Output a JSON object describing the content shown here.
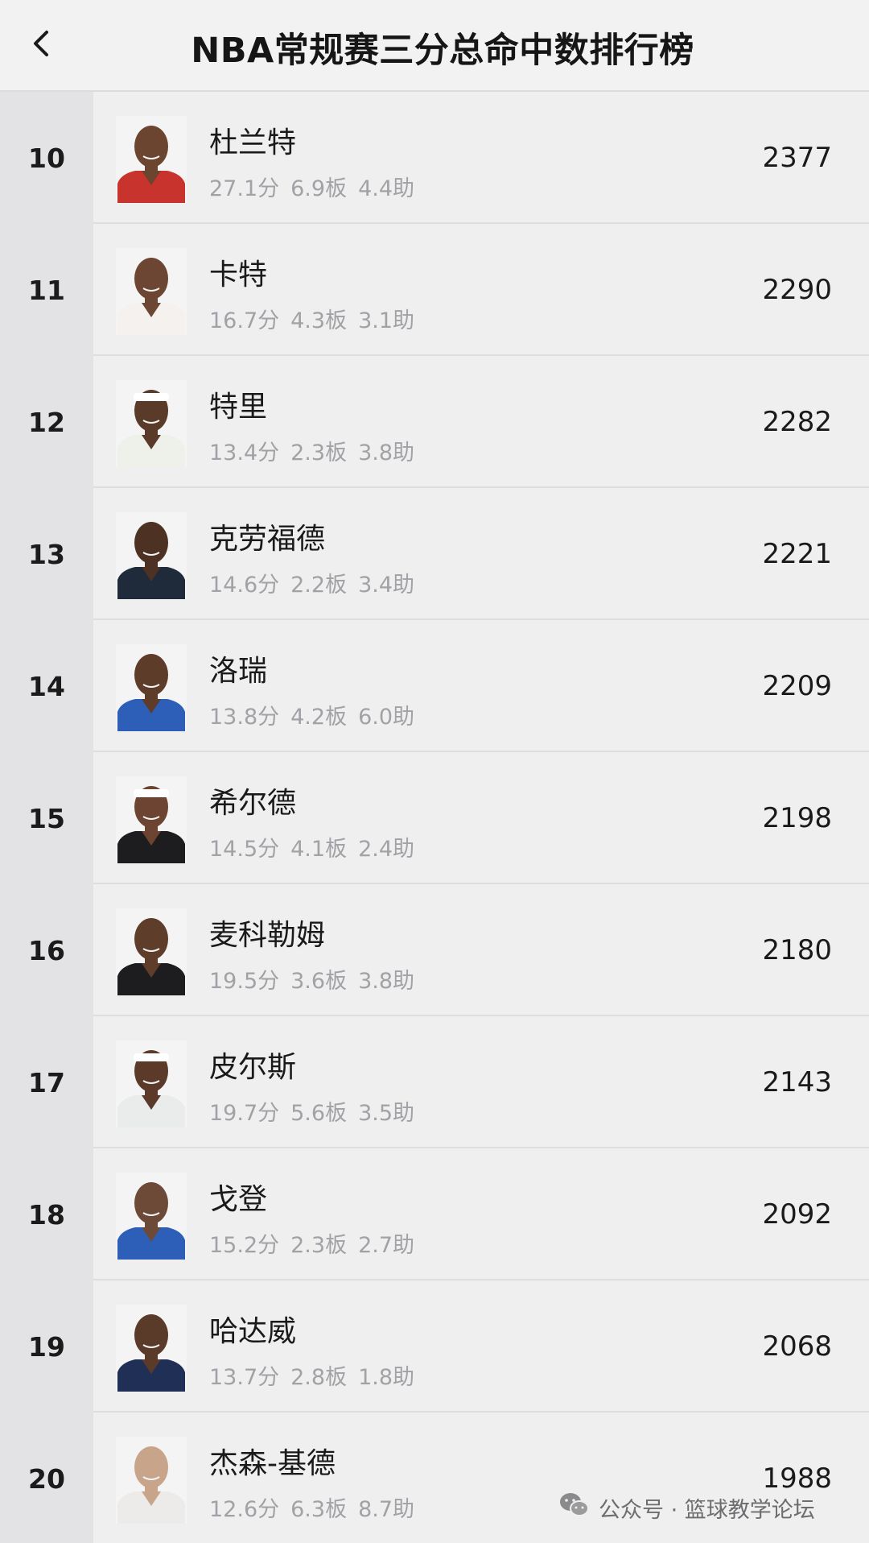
{
  "header": {
    "title": "NBA常规赛三分总命中数排行榜",
    "back_icon": "chevron-left-icon"
  },
  "rows": [
    {
      "rank": "10",
      "name": "杜兰特",
      "pts": "27.1分",
      "reb": "6.9板",
      "ast": "4.4助",
      "value": "2377",
      "jersey": "#c8332e",
      "skin": "#6b4530",
      "band": ""
    },
    {
      "rank": "11",
      "name": "卡特",
      "pts": "16.7分",
      "reb": "4.3板",
      "ast": "3.1助",
      "value": "2290",
      "jersey": "#f4f1ee",
      "skin": "#6d4633",
      "band": ""
    },
    {
      "rank": "12",
      "name": "特里",
      "pts": "13.4分",
      "reb": "2.3板",
      "ast": "3.8助",
      "value": "2282",
      "jersey": "#eef0ea",
      "skin": "#5a3a28",
      "band": "#ffffff"
    },
    {
      "rank": "13",
      "name": "克劳福德",
      "pts": "14.6分",
      "reb": "2.2板",
      "ast": "3.4助",
      "value": "2221",
      "jersey": "#1f2a3a",
      "skin": "#4d3223",
      "band": ""
    },
    {
      "rank": "14",
      "name": "洛瑞",
      "pts": "13.8分",
      "reb": "4.2板",
      "ast": "6.0助",
      "value": "2209",
      "jersey": "#2d5fb8",
      "skin": "#5e3c2a",
      "band": ""
    },
    {
      "rank": "15",
      "name": "希尔德",
      "pts": "14.5分",
      "reb": "4.1板",
      "ast": "2.4助",
      "value": "2198",
      "jersey": "#1d1d1f",
      "skin": "#6c4431",
      "band": "#ffffff"
    },
    {
      "rank": "16",
      "name": "麦科勒姆",
      "pts": "19.5分",
      "reb": "3.6板",
      "ast": "3.8助",
      "value": "2180",
      "jersey": "#1d1d1f",
      "skin": "#5e3d2b",
      "band": ""
    },
    {
      "rank": "17",
      "name": "皮尔斯",
      "pts": "19.7分",
      "reb": "5.6板",
      "ast": "3.5助",
      "value": "2143",
      "jersey": "#e9ecea",
      "skin": "#5b3a29",
      "band": "#ffffff"
    },
    {
      "rank": "18",
      "name": "戈登",
      "pts": "15.2分",
      "reb": "2.3板",
      "ast": "2.7助",
      "value": "2092",
      "jersey": "#2d5fb8",
      "skin": "#6c4a37",
      "band": ""
    },
    {
      "rank": "19",
      "name": "哈达威",
      "pts": "13.7分",
      "reb": "2.8板",
      "ast": "1.8助",
      "value": "2068",
      "jersey": "#1f2f55",
      "skin": "#5a3a29",
      "band": ""
    },
    {
      "rank": "20",
      "name": "杰森-基德",
      "pts": "12.6分",
      "reb": "6.3板",
      "ast": "8.7助",
      "value": "1988",
      "jersey": "#ecebe9",
      "skin": "#c7a48a",
      "band": ""
    }
  ],
  "watermark": {
    "text": "公众号 · 篮球教学论坛",
    "icon": "wechat-icon"
  }
}
